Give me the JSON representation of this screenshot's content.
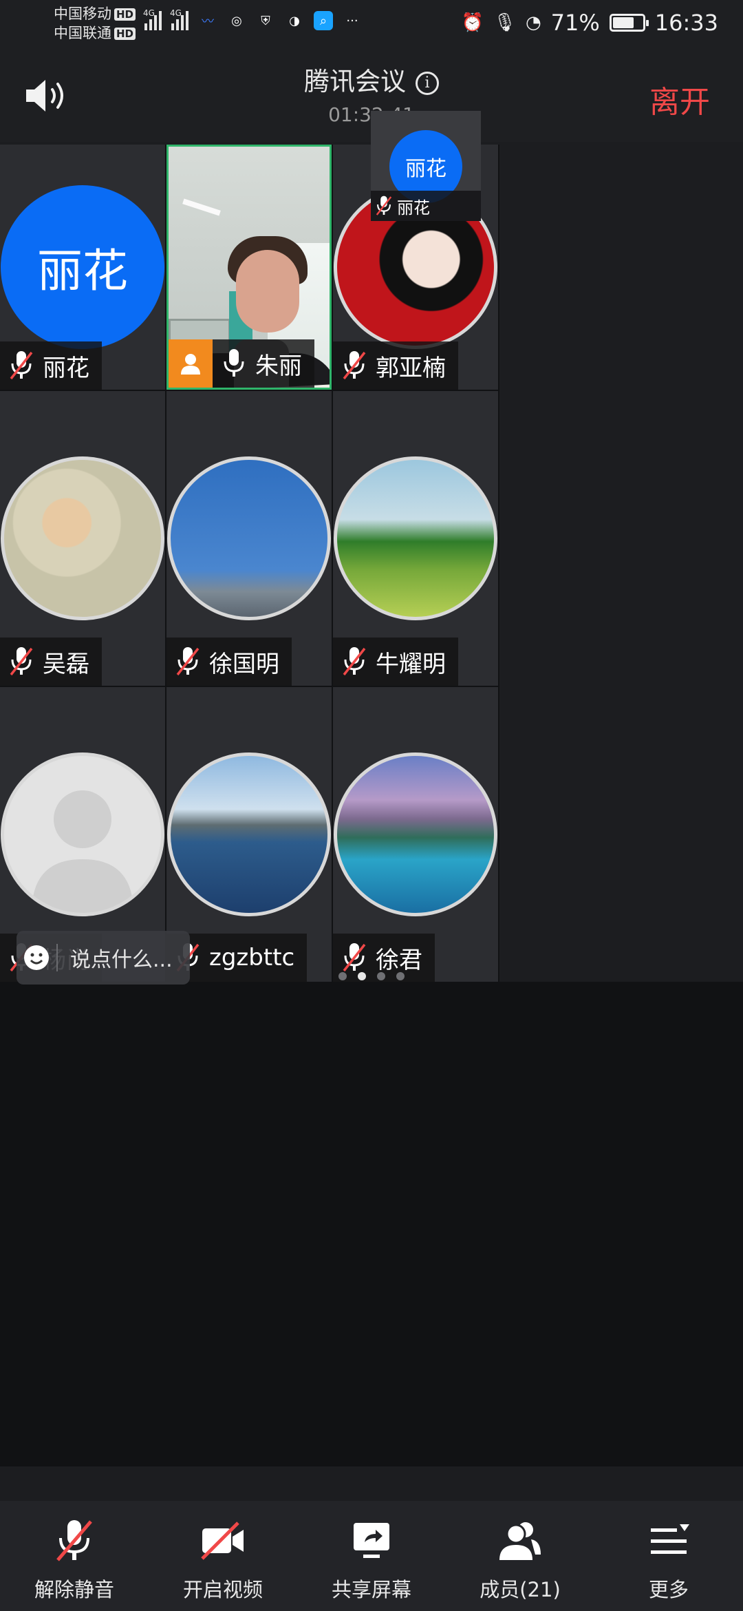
{
  "status_bar": {
    "carrier1": "中国移动",
    "carrier2": "中国联通",
    "hd": "HD",
    "net1": "4G",
    "net2": "4G",
    "more": "···",
    "battery_pct": "71%",
    "battery_level": 0.71,
    "time": "16:33"
  },
  "header": {
    "title": "腾讯会议",
    "timer": "01:32:41",
    "leave_label": "离开"
  },
  "mini_view": {
    "initials": "丽花",
    "name": "丽花"
  },
  "participants": [
    {
      "name": "丽花",
      "avatar_text": "丽花",
      "muted": true,
      "type": "initials"
    },
    {
      "name": "朱丽",
      "muted": false,
      "type": "video",
      "host": true
    },
    {
      "name": "郭亚楠",
      "muted": true,
      "type": "photo",
      "avatar": "cartoon-girl-avatar"
    },
    {
      "name": "吴磊",
      "muted": true,
      "type": "photo",
      "avatar": "illustration-children-avatar"
    },
    {
      "name": "徐国明",
      "muted": true,
      "type": "photo",
      "avatar": "blue-sky-avatar"
    },
    {
      "name": "牛耀明",
      "muted": true,
      "type": "photo",
      "avatar": "green-field-avatar"
    },
    {
      "name": "杨尚",
      "muted": true,
      "type": "photo",
      "avatar": "default-person-avatar"
    },
    {
      "name": "zgzbttc",
      "muted": true,
      "type": "photo",
      "avatar": "lake-avatar"
    },
    {
      "name": "徐君",
      "muted": true,
      "type": "photo",
      "avatar": "mountain-lake-avatar"
    }
  ],
  "chat": {
    "placeholder": "说点什么..."
  },
  "pagination": {
    "pages": 4,
    "current": 2
  },
  "toolbar": {
    "unmute": "解除静音",
    "video": "开启视频",
    "share": "共享屏幕",
    "members": "成员(21)",
    "more": "更多"
  },
  "colors": {
    "leave": "#f04848",
    "initials_bg": "#0a6cf5",
    "active_border": "#2fb56a",
    "host_badge": "#f28a1e"
  }
}
